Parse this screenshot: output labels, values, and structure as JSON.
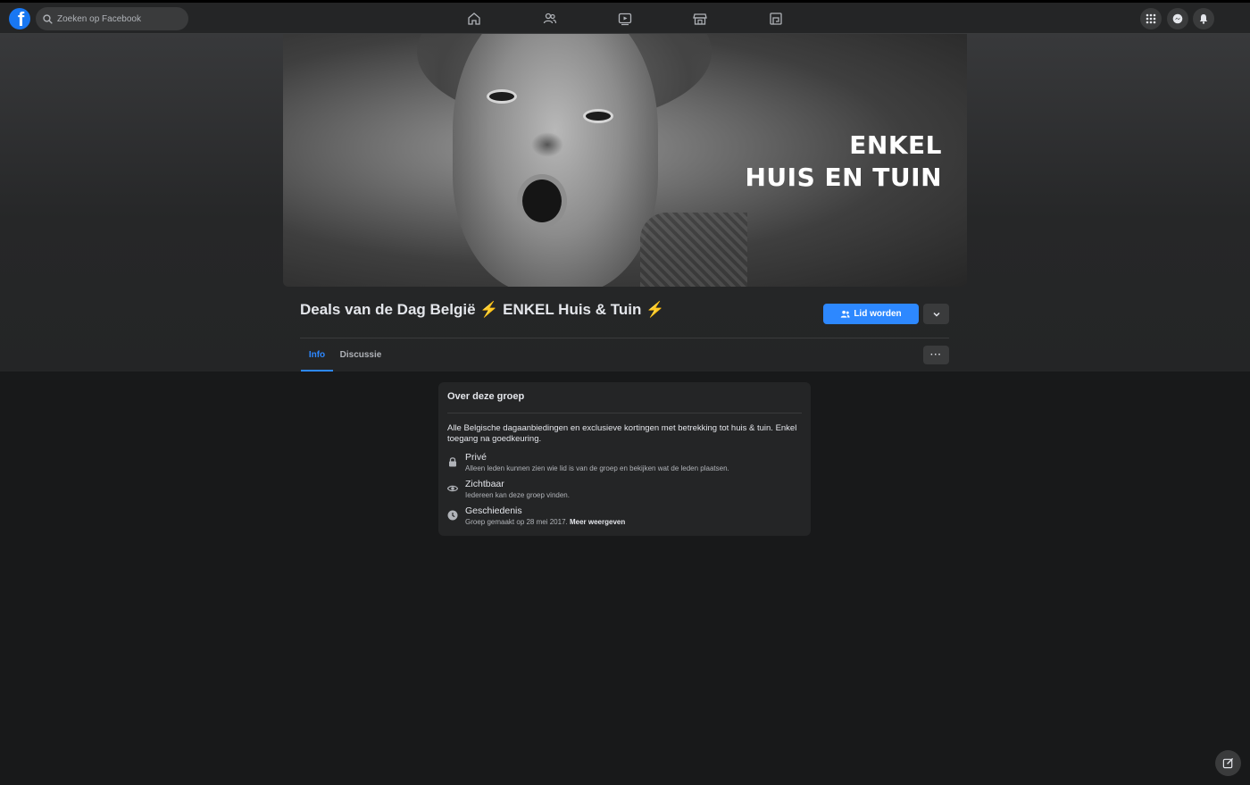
{
  "topbar": {
    "search_placeholder": "Zoeken op Facebook",
    "nav_icons": [
      "home-icon",
      "friends-icon",
      "watch-icon",
      "marketplace-icon",
      "gaming-icon"
    ],
    "right_icons": [
      "menu-grid-icon",
      "messenger-icon",
      "notifications-icon"
    ]
  },
  "cover": {
    "line1": "ENKEL",
    "line2": "HUIS EN TUIN"
  },
  "group": {
    "title": "Deals van de Dag België ⚡ ENKEL Huis & Tuin ⚡",
    "join_label": "Lid worden"
  },
  "tabs": [
    {
      "label": "Info",
      "active": true
    },
    {
      "label": "Discussie",
      "active": false
    }
  ],
  "more_label": "···",
  "about": {
    "title": "Over deze groep",
    "description": "Alle Belgische dagaanbiedingen en exclusieve kortingen met betrekking tot huis & tuin. Enkel toegang na goedkeuring.",
    "items": [
      {
        "icon": "lock-icon",
        "label": "Privé",
        "sub": "Alleen leden kunnen zien wie lid is van de groep en bekijken wat de leden plaatsen."
      },
      {
        "icon": "eye-icon",
        "label": "Zichtbaar",
        "sub": "Iedereen kan deze groep vinden."
      },
      {
        "icon": "clock-icon",
        "label": "Geschiedenis",
        "sub": "Groep gemaakt op 28 mei 2017.",
        "link": "Meer weergeven"
      }
    ]
  },
  "colors": {
    "accent": "#2d88ff",
    "background": "#18191a",
    "surface": "#242526"
  }
}
